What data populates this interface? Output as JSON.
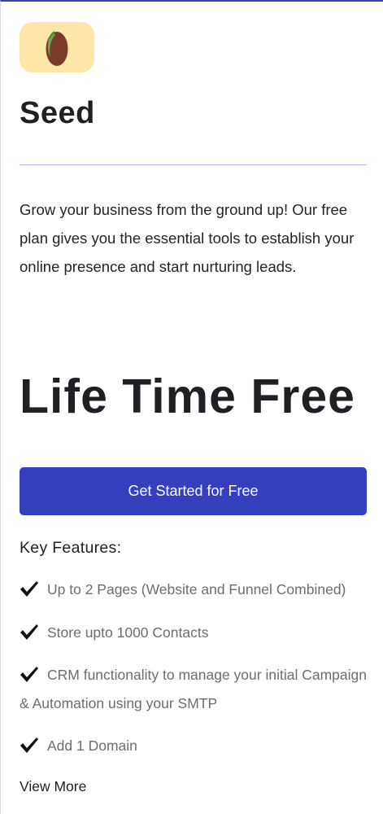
{
  "plan": {
    "icon": "seed-icon",
    "name": "Seed",
    "description": "Grow your business from the ground up! Our free plan gives you the essential tools to establish your online presence and start nurturing leads.",
    "price": "Life Time Free",
    "cta_label": "Get Started for Free"
  },
  "features": {
    "heading": "Key Features:",
    "icon": "checkmark-icon",
    "items": [
      "Up to 2 Pages (Website and Funnel Combined)",
      "Store upto 1000 Contacts",
      "CRM functionality to manage your initial Campaign & Automation using your SMTP",
      "Add 1 Domain"
    ]
  },
  "view_more_label": "View More",
  "colors": {
    "accent": "#3640bf",
    "icon_background": "#fde6a8",
    "seed": "#7a3b2b",
    "sprout": "#6aa84f"
  }
}
